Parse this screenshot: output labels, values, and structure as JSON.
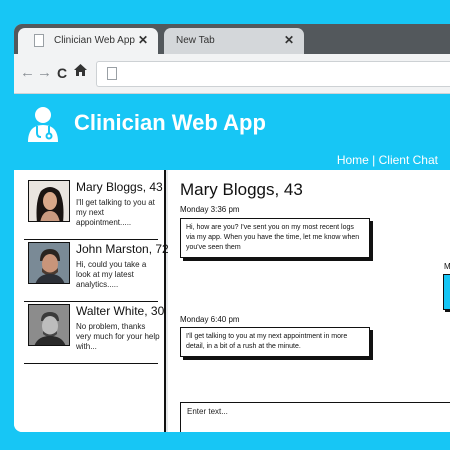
{
  "browser": {
    "tabs": [
      {
        "title": "Clinician Web App",
        "close": "✕",
        "active": true
      },
      {
        "title": "New Tab",
        "close": "✕",
        "active": false
      }
    ],
    "nav": {
      "back": "←",
      "forward": "→",
      "reload": "C",
      "home": "⌂"
    },
    "address_value": ""
  },
  "app": {
    "title": "Clinician Web App",
    "nav_home": "Home",
    "nav_sep": " | ",
    "nav_chat": "Client Chat",
    "accent_color": "#17c6f5"
  },
  "contacts": [
    {
      "name": "Mary Bloggs, 43",
      "preview": "I'll get talking to you at my next appointment....."
    },
    {
      "name": "John Marston, 72",
      "preview": "Hi, could you take a look at my latest analytics....."
    },
    {
      "name": "Walter White, 30",
      "preview": "No problem, thanks very much for your help with..."
    }
  ],
  "chat": {
    "contact_name": "Mary Bloggs, 43",
    "messages": [
      {
        "timestamp": "Monday 3:36 pm",
        "text": "Hi, how are you? I've sent you on my most recent logs via my app. When you have the time, let me know when you've seen them"
      },
      {
        "timestamp": "Monday 6:40 pm",
        "text": "I'll get talking to you at my next appointment in more detail, in a bit of a rush at the minute."
      }
    ],
    "sent_stub_timestamp": "M",
    "input_placeholder": "Enter text..."
  }
}
